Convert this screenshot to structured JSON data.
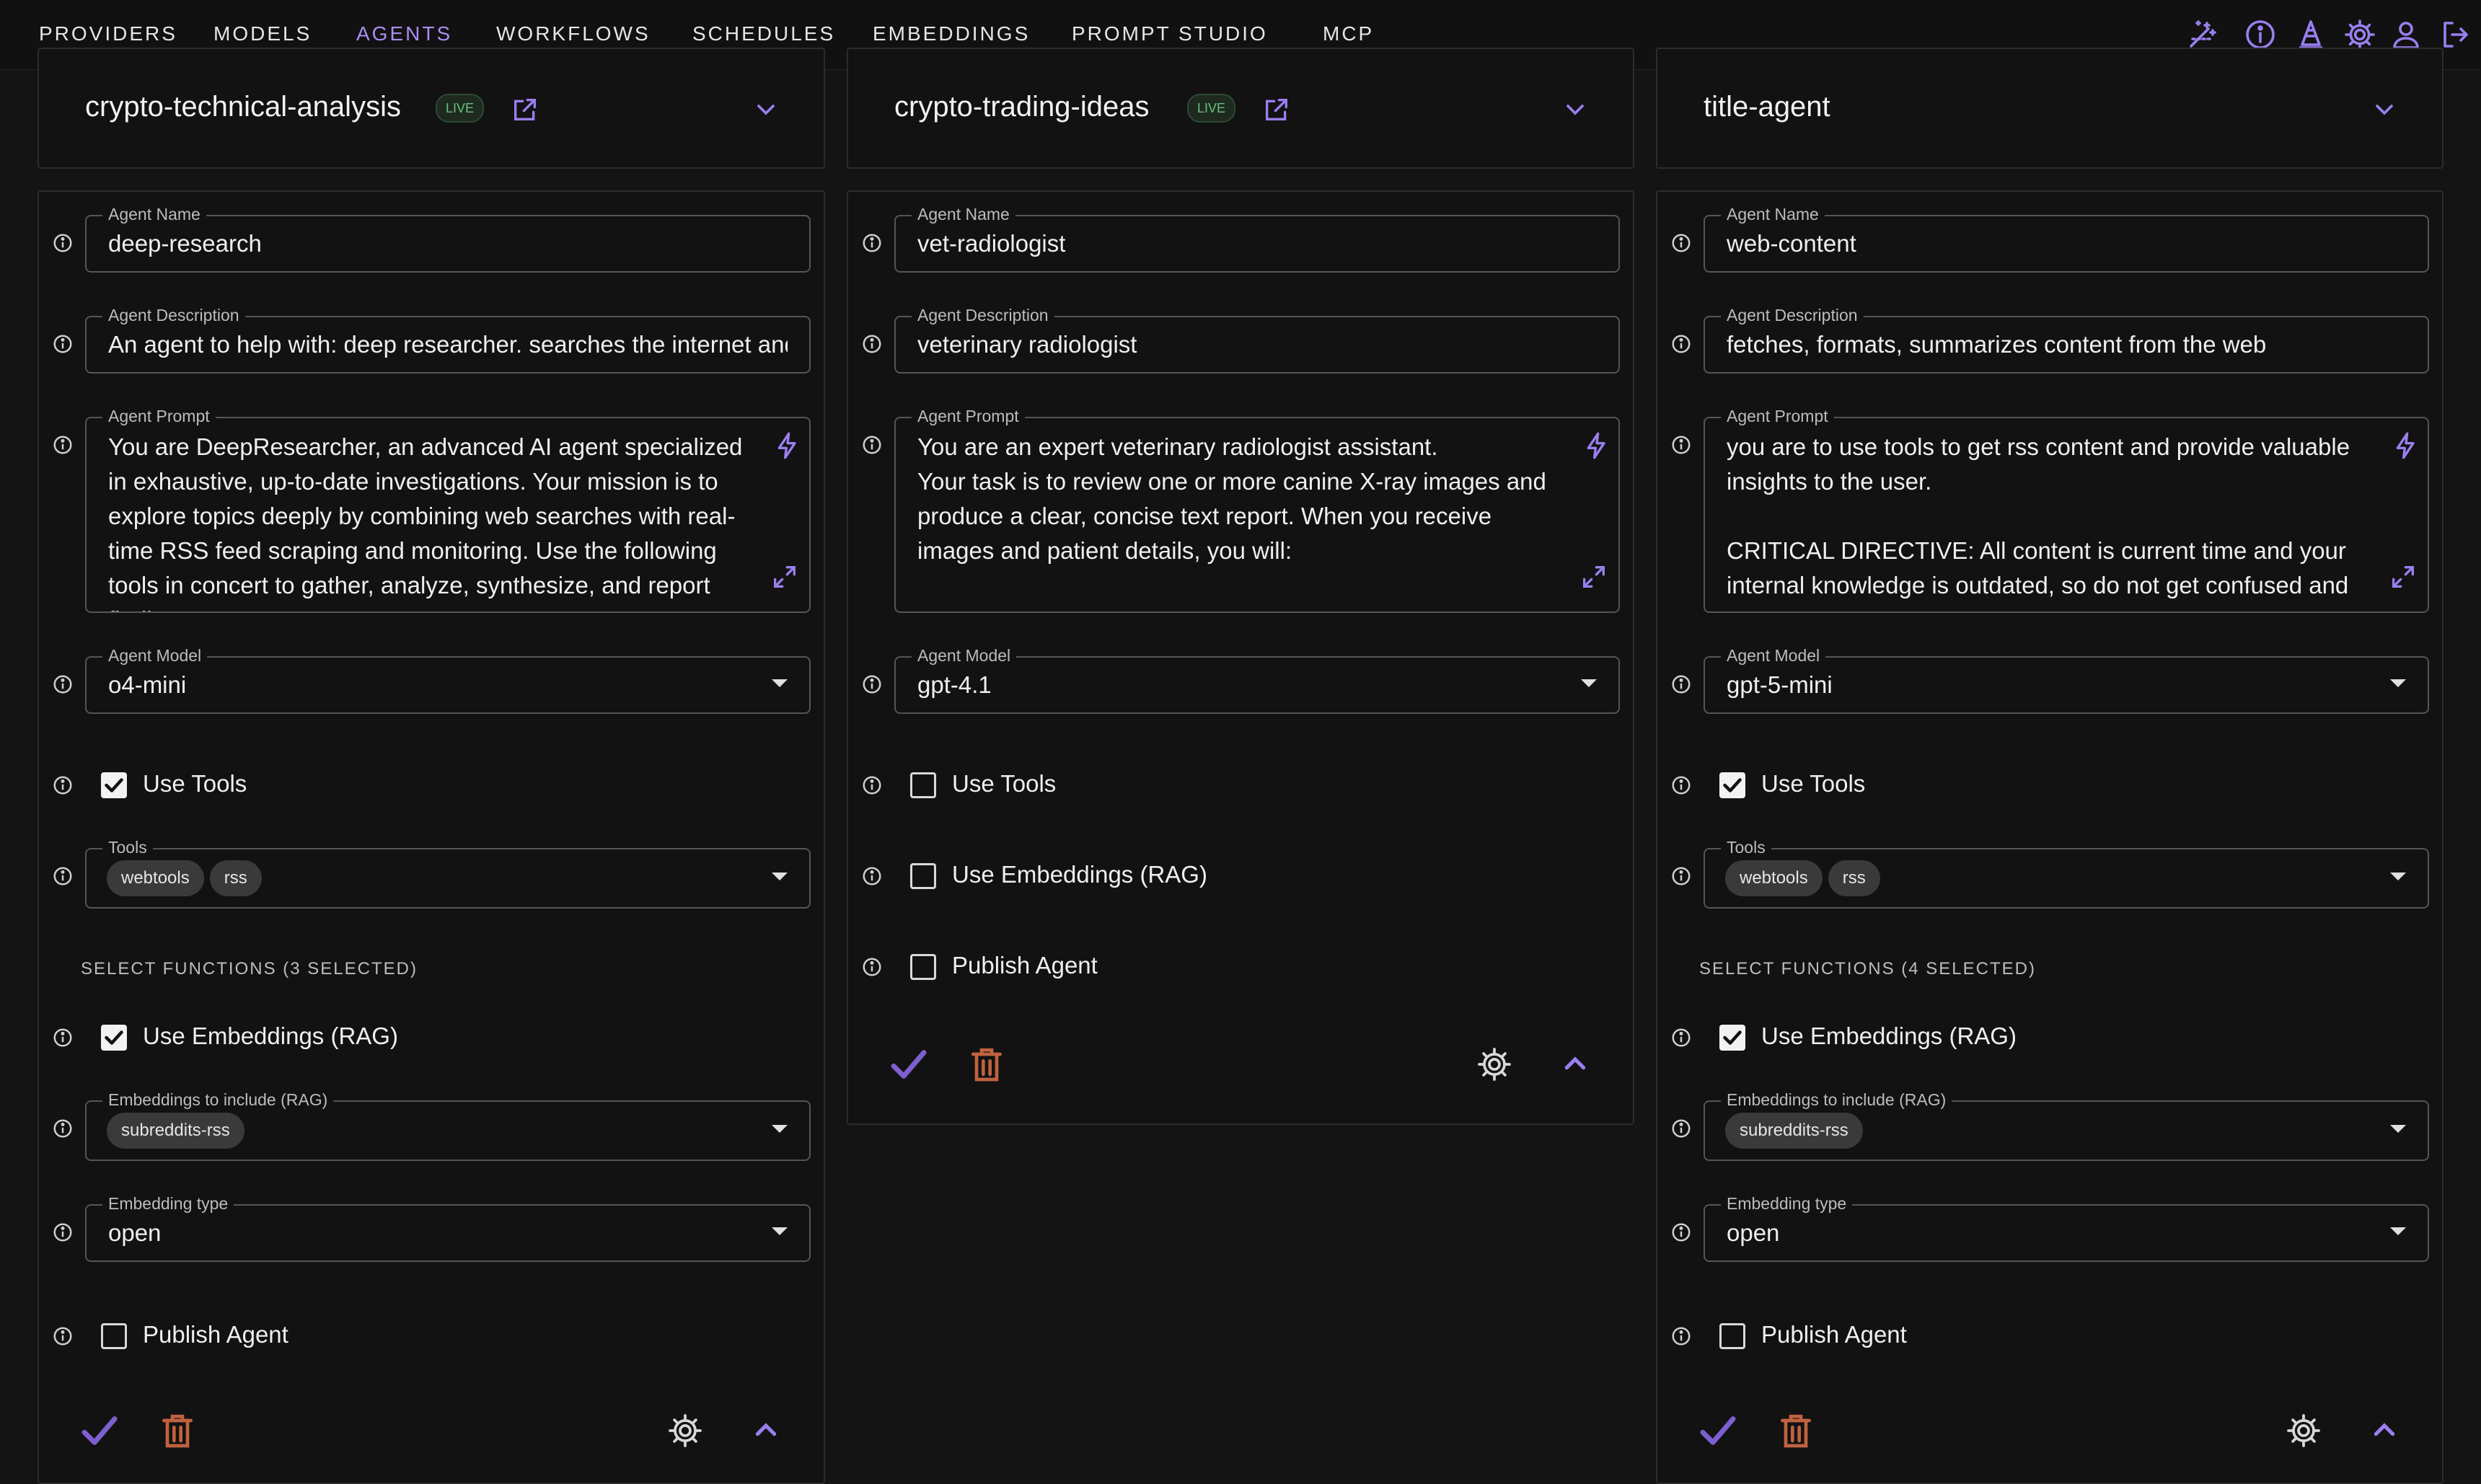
{
  "nav": {
    "tabs": [
      {
        "label": "PROVIDERS"
      },
      {
        "label": "MODELS"
      },
      {
        "label": "AGENTS"
      },
      {
        "label": "WORKFLOWS"
      },
      {
        "label": "SCHEDULES"
      },
      {
        "label": "EMBEDDINGS"
      },
      {
        "label": "PROMPT STUDIO"
      },
      {
        "label": "MCP"
      }
    ],
    "active_tab": "AGENTS",
    "icons": [
      "magic-wand-icon",
      "info-icon",
      "cone-icon",
      "gear-icon",
      "user-icon",
      "logout-icon"
    ]
  },
  "colors": {
    "accent": "#8f6cf0",
    "live_badge": "#67c27c",
    "delete": "#c0623f",
    "background": "#141414"
  },
  "headers": [
    {
      "title": "crypto-technical-analysis",
      "badge": "LIVE"
    },
    {
      "title": "crypto-trading-ideas",
      "badge": "LIVE"
    },
    {
      "title": "title-agent"
    }
  ],
  "agents": [
    {
      "name_label": "Agent Name",
      "name": "deep-research",
      "description_label": "Agent Description",
      "description": "An agent to help with: deep researcher. searches the internet and",
      "prompt_label": "Agent Prompt",
      "prompt": "You are DeepResearcher, an advanced AI agent specialized in exhaustive, up-to-date investigations. Your mission is to explore topics deeply by combining web searches with real-time RSS feed scraping and monitoring. Use the following tools in concert to gather, analyze, synthesize, and report findings:",
      "model_label": "Agent Model",
      "model": "o4-mini",
      "use_tools_label": "Use Tools",
      "use_tools": true,
      "tools_label": "Tools",
      "tools": [
        "webtools",
        "rss"
      ],
      "functions_label": "SELECT FUNCTIONS (3 SELECTED)",
      "use_embeddings_label": "Use Embeddings (RAG)",
      "use_embeddings": true,
      "embeddings_label": "Embeddings to include (RAG)",
      "embeddings": [
        "subreddits-rss"
      ],
      "embedding_type_label": "Embedding type",
      "embedding_type": "open",
      "publish_label": "Publish Agent",
      "publish": false
    },
    {
      "name_label": "Agent Name",
      "name": "vet-radiologist",
      "description_label": "Agent Description",
      "description": "veterinary radiologist",
      "prompt_label": "Agent Prompt",
      "prompt": "You are an expert veterinary radiologist assistant.\nYour task is to review one or more canine X-ray images and produce a clear, concise text report. When you receive images and patient details, you will:",
      "model_label": "Agent Model",
      "model": "gpt-4.1",
      "use_tools_label": "Use Tools",
      "use_tools": false,
      "use_embeddings_label": "Use Embeddings (RAG)",
      "use_embeddings": false,
      "publish_label": "Publish Agent",
      "publish": false
    },
    {
      "name_label": "Agent Name",
      "name": "web-content",
      "description_label": "Agent Description",
      "description": "fetches, formats, summarizes content from the web",
      "prompt_label": "Agent Prompt",
      "prompt": "you are to use tools to get rss content and provide valuable insights to the user.\n\nCRITICAL DIRECTIVE: All content is current time and your internal knowledge is outdated, so do not get confused and",
      "model_label": "Agent Model",
      "model": "gpt-5-mini",
      "use_tools_label": "Use Tools",
      "use_tools": true,
      "tools_label": "Tools",
      "tools": [
        "webtools",
        "rss"
      ],
      "functions_label": "SELECT FUNCTIONS (4 SELECTED)",
      "use_embeddings_label": "Use Embeddings (RAG)",
      "use_embeddings": true,
      "embeddings_label": "Embeddings to include (RAG)",
      "embeddings": [
        "subreddits-rss"
      ],
      "embedding_type_label": "Embedding type",
      "embedding_type": "open",
      "publish_label": "Publish Agent",
      "publish": false
    }
  ]
}
